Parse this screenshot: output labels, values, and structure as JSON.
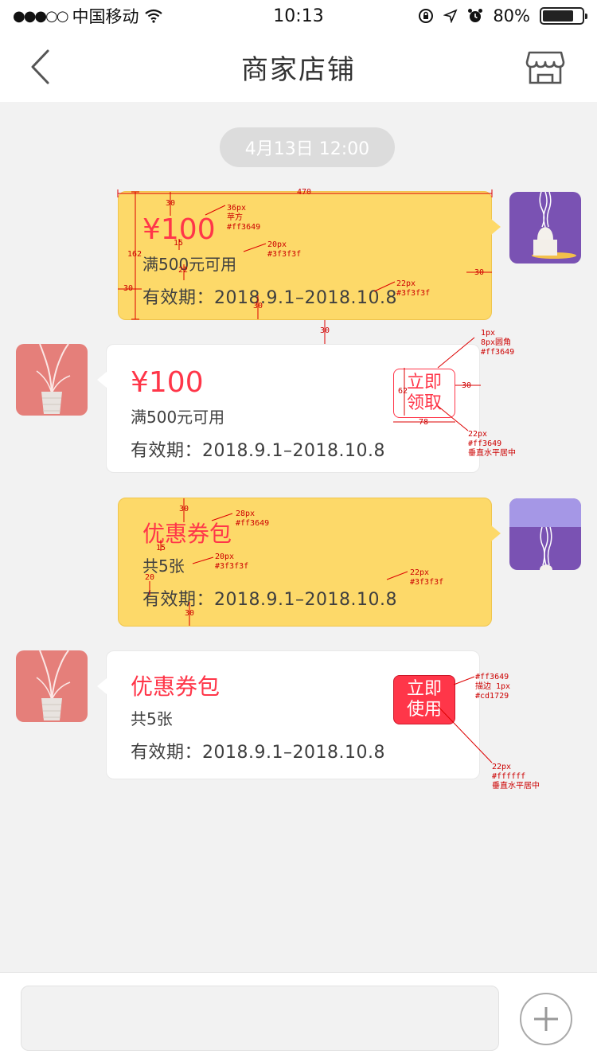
{
  "status_bar": {
    "carrier": "中国移动",
    "time": "10:13",
    "battery": "80%",
    "battery_level": 0.8
  },
  "nav": {
    "title": "商家店铺"
  },
  "chat": {
    "date": "4月13日 12:00",
    "messages": [
      {
        "type": "coupon",
        "side": "right",
        "amount": "¥100",
        "condition": "满500元可用",
        "validity": "有效期：2018.9.1–2018.10.8"
      },
      {
        "type": "coupon",
        "side": "left",
        "amount": "¥100",
        "condition": "满500元可用",
        "validity": "有效期：2018.9.1–2018.10.8",
        "button": "立即领取"
      },
      {
        "type": "coupon_pack",
        "side": "right",
        "title": "优惠券包",
        "count": "共5张",
        "validity": "有效期：2018.9.1–2018.10.8"
      },
      {
        "type": "coupon_pack",
        "side": "left",
        "title": "优惠券包",
        "count": "共5张",
        "validity": "有效期：2018.9.1–2018.10.8",
        "button": "立即使用"
      }
    ]
  },
  "annotations": {
    "a_470": "470",
    "a_30a": "30",
    "a_36px": "36px\n苹方\n#ff3649",
    "a_15a": "15",
    "a_20px_a": "20px\n#3f3f3f",
    "a_162": "162",
    "a_22a": "22",
    "a_30b": "30",
    "a_22px_a": "22px\n#3f3f3f",
    "a_30c": "30",
    "a_30d": "30",
    "a_30e": "30",
    "a_1px": "1px\n8px圆角\n#ff3649",
    "a_62": "62",
    "a_30f": "30",
    "a_78": "78",
    "a_22px_b": "22px\n#ff3649\n垂直水平居中",
    "a_30g": "30",
    "a_28px": "28px\n#ff3649",
    "a_15b": "15",
    "a_20px_b": "20px\n#3f3f3f",
    "a_20": "20",
    "a_22px_c": "22px\n#3f3f3f",
    "a_30h": "30",
    "a_ff3649": "#ff3649\n描边 1px\n#cd1729",
    "a_22px_d": "22px\n#ffffff\n垂直水平居中"
  },
  "colors": {
    "accent": "#ff3649",
    "stroke": "#cd1729",
    "text": "#3f3f3f",
    "bubble_yellow": "#fdd969"
  }
}
